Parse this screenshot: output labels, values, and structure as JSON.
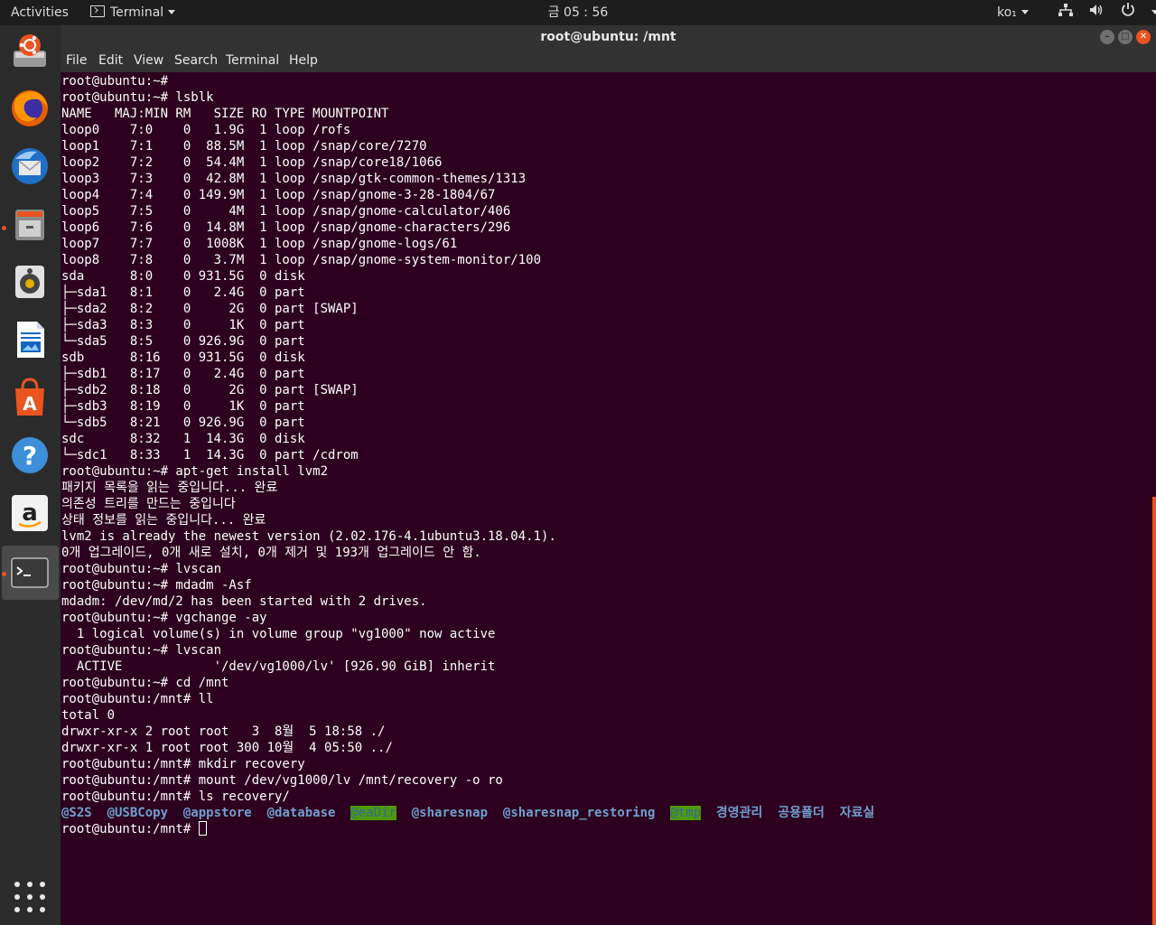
{
  "top_panel": {
    "activities": "Activities",
    "app_menu": "Terminal",
    "clock": "금 05 : 56",
    "lang": "ko₁",
    "icons": [
      "network-icon",
      "volume-icon",
      "power-icon"
    ]
  },
  "window": {
    "title": "root@ubuntu: /mnt",
    "buttons": [
      "minimize",
      "maximize",
      "close"
    ]
  },
  "menu": [
    "File",
    "Edit",
    "View",
    "Search",
    "Terminal",
    "Help"
  ],
  "dock": {
    "items": [
      "ubuntu-software-installer",
      "firefox",
      "thunderbird",
      "files",
      "rhythmbox",
      "libreoffice-writer",
      "ubuntu-software",
      "help",
      "amazon",
      "terminal"
    ],
    "running": [
      "files",
      "terminal"
    ],
    "active": "terminal"
  },
  "colors": {
    "terminal_bg": "#2c001e",
    "accent": "#e95420",
    "dir_text": "#729fcf",
    "highlight_bg": "#4e9a06"
  },
  "terminal": {
    "lines": [
      "root@ubuntu:~#",
      "root@ubuntu:~# lsblk",
      "NAME   MAJ:MIN RM   SIZE RO TYPE MOUNTPOINT",
      "loop0    7:0    0   1.9G  1 loop /rofs",
      "loop1    7:1    0  88.5M  1 loop /snap/core/7270",
      "loop2    7:2    0  54.4M  1 loop /snap/core18/1066",
      "loop3    7:3    0  42.8M  1 loop /snap/gtk-common-themes/1313",
      "loop4    7:4    0 149.9M  1 loop /snap/gnome-3-28-1804/67",
      "loop5    7:5    0     4M  1 loop /snap/gnome-calculator/406",
      "loop6    7:6    0  14.8M  1 loop /snap/gnome-characters/296",
      "loop7    7:7    0  1008K  1 loop /snap/gnome-logs/61",
      "loop8    7:8    0   3.7M  1 loop /snap/gnome-system-monitor/100",
      "sda      8:0    0 931.5G  0 disk",
      "├─sda1   8:1    0   2.4G  0 part",
      "├─sda2   8:2    0     2G  0 part [SWAP]",
      "├─sda3   8:3    0     1K  0 part",
      "└─sda5   8:5    0 926.9G  0 part",
      "sdb      8:16   0 931.5G  0 disk",
      "├─sdb1   8:17   0   2.4G  0 part",
      "├─sdb2   8:18   0     2G  0 part [SWAP]",
      "├─sdb3   8:19   0     1K  0 part",
      "└─sdb5   8:21   0 926.9G  0 part",
      "sdc      8:32   1  14.3G  0 disk",
      "└─sdc1   8:33   1  14.3G  0 part /cdrom",
      "root@ubuntu:~# apt-get install lvm2",
      "패키지 목록을 읽는 중입니다... 완료",
      "의존성 트리를 만드는 중입니다",
      "상태 정보를 읽는 중입니다... 완료",
      "lvm2 is already the newest version (2.02.176-4.1ubuntu3.18.04.1).",
      "0개 업그레이드, 0개 새로 설치, 0개 제거 및 193개 업그레이드 안 함.",
      "root@ubuntu:~# lvscan",
      "root@ubuntu:~# mdadm -Asf",
      "mdadm: /dev/md/2 has been started with 2 drives.",
      "root@ubuntu:~# vgchange -ay",
      "  1 logical volume(s) in volume group \"vg1000\" now active",
      "root@ubuntu:~# lvscan",
      "  ACTIVE            '/dev/vg1000/lv' [926.90 GiB] inherit",
      "root@ubuntu:~# cd /mnt",
      "root@ubuntu:/mnt# ll",
      "total 0",
      "drwxr-xr-x 2 root root   3  8월  5 18:58 ./",
      "drwxr-xr-x 1 root root 300 10월  4 05:50 ../",
      "root@ubuntu:/mnt# mkdir recovery",
      "root@ubuntu:/mnt# mount /dev/vg1000/lv /mnt/recovery -o ro",
      "root@ubuntu:/mnt# ls recovery/"
    ],
    "ls_output": [
      {
        "name": "@S2S",
        "style": "dir"
      },
      {
        "name": "@USBCopy",
        "style": "dir"
      },
      {
        "name": "@appstore",
        "style": "dir"
      },
      {
        "name": "@database",
        "style": "dir"
      },
      {
        "name": "@eaDir",
        "style": "highlight"
      },
      {
        "name": "@sharesnap",
        "style": "dir"
      },
      {
        "name": "@sharesnap_restoring",
        "style": "dir"
      },
      {
        "name": "@tmp",
        "style": "highlight"
      },
      {
        "name": "경영관리",
        "style": "dir"
      },
      {
        "name": "공용폴더",
        "style": "dir"
      },
      {
        "name": "자료실",
        "style": "dir"
      }
    ],
    "prompt": "root@ubuntu:/mnt# "
  }
}
